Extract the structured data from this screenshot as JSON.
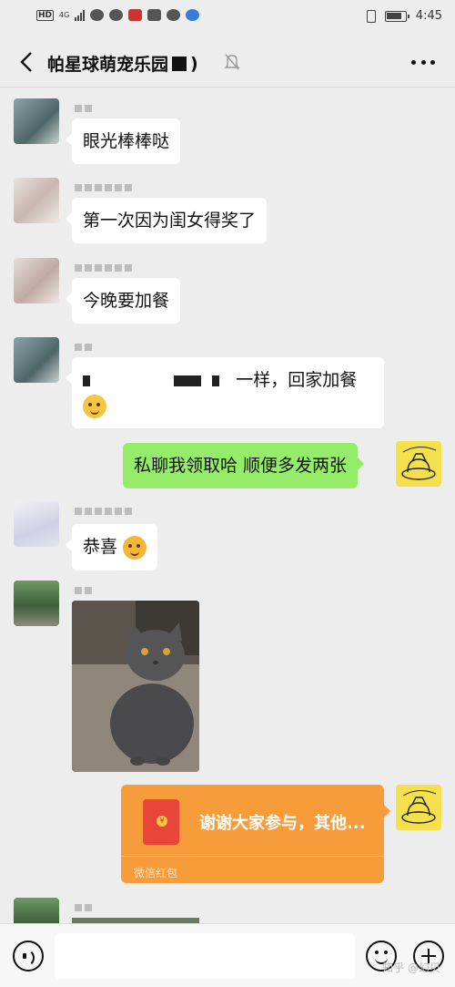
{
  "status_bar": {
    "network": "HD",
    "signal_label": "4G",
    "time": "4:45"
  },
  "header": {
    "title": "帕星球萌宠乐园",
    "title_suffix": ")"
  },
  "messages": [
    {
      "text": "眼光棒棒哒"
    },
    {
      "text": "第一次因为闺女得奖了"
    },
    {
      "text": "今晚要加餐"
    },
    {
      "text": "一样，回家加餐"
    },
    {
      "text": "私聊我领取哈  顺便多发两张"
    },
    {
      "text": "恭喜"
    },
    {
      "type": "image",
      "content": "gray cat photo"
    },
    {
      "type": "red_packet",
      "text": "谢谢大家参与，其他...",
      "label": "微信红包"
    }
  ],
  "input": {
    "placeholder": ""
  },
  "watermark": "知乎 @幻贝",
  "colors": {
    "green_bubble": "#95ec69",
    "red_packet": "#f79c3a",
    "background": "#ededed"
  },
  "icons": [
    "back-icon",
    "bell-off-icon",
    "more-icon",
    "voice-icon",
    "emoji-icon",
    "plus-icon",
    "red-packet-icon"
  ]
}
